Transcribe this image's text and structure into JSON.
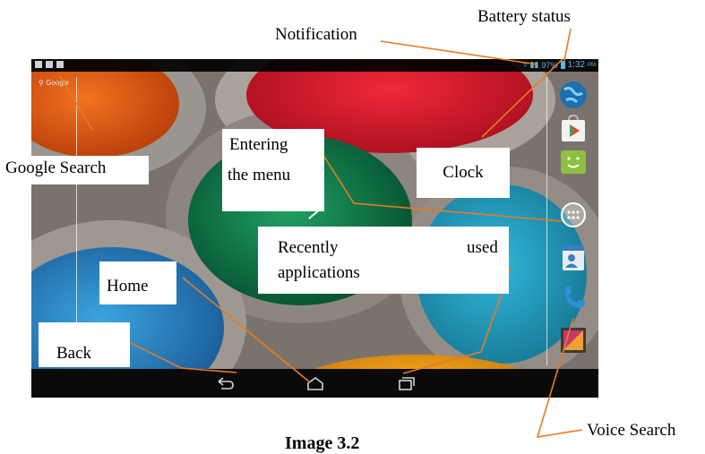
{
  "status_bar": {
    "battery_percent": "97%",
    "time": "1:32",
    "time_suffix": "PM"
  },
  "search_widget": {
    "label": "Google"
  },
  "dock": {
    "items": [
      {
        "icon": "globe-icon"
      },
      {
        "icon": "play-store-icon"
      },
      {
        "icon": "android-icon"
      },
      {
        "icon": "app-drawer-icon"
      },
      {
        "icon": "contacts-icon"
      },
      {
        "icon": "phone-icon"
      },
      {
        "icon": "gallery-icon"
      }
    ]
  },
  "nav_bar": {
    "buttons": [
      "back-icon",
      "home-icon",
      "recent-apps-icon"
    ]
  },
  "labels": {
    "battery": "Battery status",
    "notification": "Notification",
    "google_search": "Google Search",
    "entering_menu_1": "Entering",
    "entering_menu_2": "the menu",
    "clock": "Clock",
    "recent_1a": "Recently",
    "recent_1b": "used",
    "recent_2": "applications",
    "home": "Home",
    "back": "Back",
    "voice_search": "Voice Search",
    "caption": "Image 3.2"
  },
  "colors": {
    "callout": "#e87b22",
    "status_icon_blue": "#5ab8f0"
  }
}
